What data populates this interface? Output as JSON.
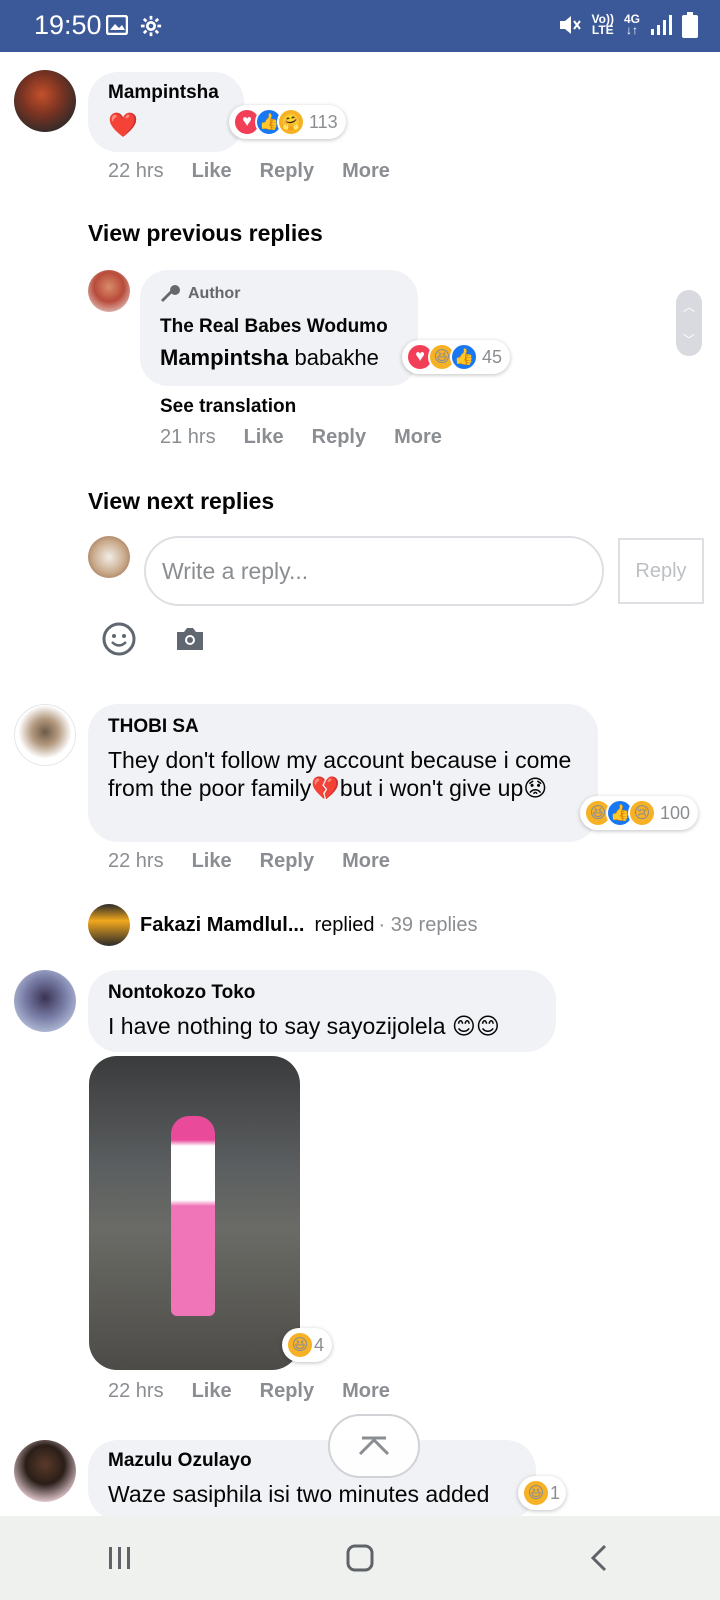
{
  "status_bar": {
    "time": "19:50",
    "network_top": "Vo))",
    "network_bottom": "LTE",
    "signal_label": "4G",
    "icons": [
      "image-icon",
      "settings-gear-icon",
      "mute-icon",
      "signal-icon",
      "battery-icon"
    ]
  },
  "comments": [
    {
      "author": "Mampintsha",
      "text": "❤️",
      "time": "22 hrs",
      "reactions": [
        "love",
        "like",
        "care"
      ],
      "reaction_count": "113"
    },
    {
      "author": "THOBI SA",
      "text": "They don't follow my account because i come from the poor family💔but i won't give up😟",
      "time": "22 hrs",
      "reactions": [
        "haha",
        "like",
        "sad"
      ],
      "reaction_count": "100"
    },
    {
      "author": "Nontokozo Toko",
      "text": "I have nothing to say sayozijolela 😊😊",
      "time": "22 hrs",
      "reactions": [
        "haha"
      ],
      "reaction_count": "4"
    },
    {
      "author": "Mazulu Ozulayo",
      "text": "Waze sasiphila isi two minutes added",
      "reactions": [
        "haha"
      ],
      "reaction_count": "1"
    }
  ],
  "reply": {
    "badge": "Author",
    "author": "The Real Babes Wodumo",
    "mention": "Mampintsha",
    "text": " babakhe",
    "see_translation": "See translation",
    "time": "21 hrs",
    "reactions": [
      "love",
      "haha",
      "like"
    ],
    "reaction_count": "45"
  },
  "actions": {
    "like": "Like",
    "reply": "Reply",
    "more": "More"
  },
  "view_previous": "View previous replies",
  "view_next": "View next replies",
  "reply_box": {
    "placeholder": "Write a reply...",
    "button": "Reply"
  },
  "replied_summary": {
    "name": "Fakazi Mamdlul...",
    "verb": "replied",
    "count": "· 39 replies"
  }
}
